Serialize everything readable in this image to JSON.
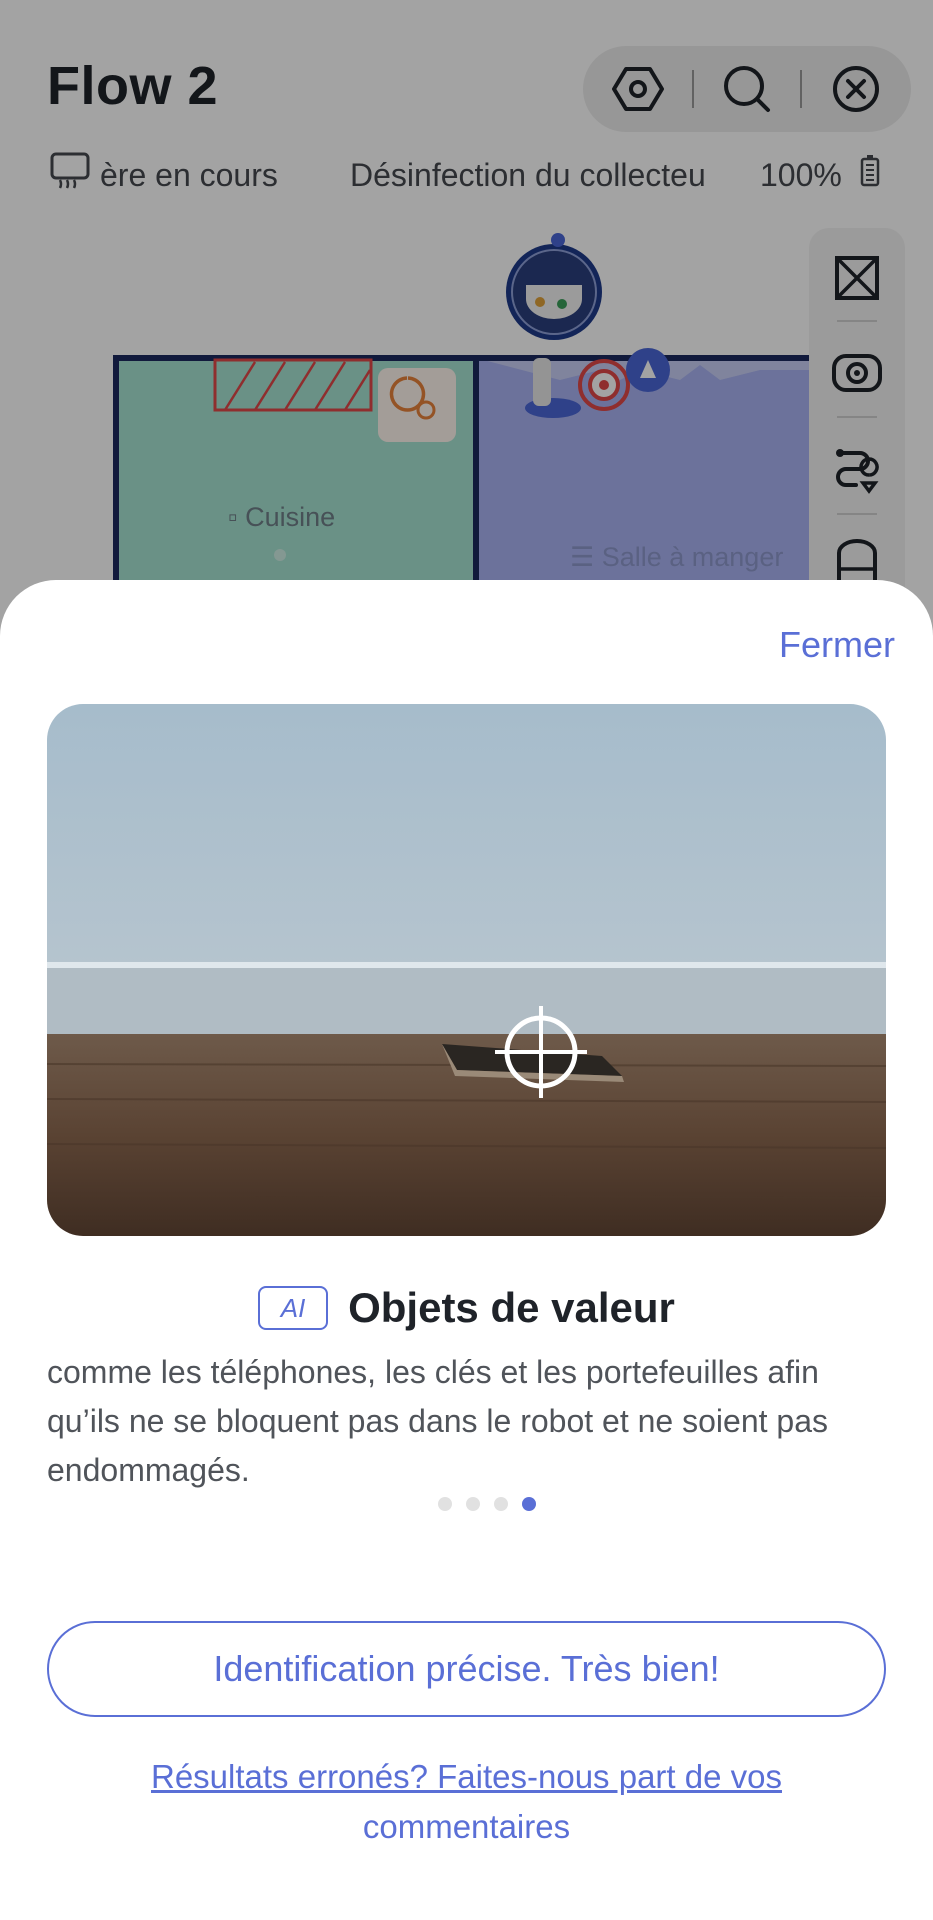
{
  "header": {
    "title": "Flow 2",
    "status_mode": "ère en cours",
    "status_task": "Désinfection du collecteu",
    "battery_percent": "100%"
  },
  "top_actions": {
    "icons": [
      "settings-hex-icon",
      "search-icon",
      "close-circle-icon"
    ]
  },
  "map": {
    "rooms": [
      {
        "name": "Cuisine",
        "color": "#a6e3d2"
      },
      {
        "name": "Salle à manger",
        "color": "#a9b3f2"
      }
    ]
  },
  "side_toolbar": {
    "icons": [
      "map-edit-icon",
      "camera-eye-icon",
      "route-pin-icon",
      "station-icon"
    ]
  },
  "sheet": {
    "close_label": "Fermer",
    "ai_badge": "AI",
    "heading": "Objets de valeur",
    "description": "comme les téléphones, les clés et les portefeuilles afin qu’ils ne se bloquent pas dans le robot et ne soient pas endommagés.",
    "page_count": 4,
    "active_page": 4,
    "confirm_label": "Identification précise. Très bien!",
    "feedback_line1": "Résultats erronés? Faites-nous part de vos",
    "feedback_line2": "commentaires"
  },
  "colors": {
    "accent": "#5a6fd6",
    "title": "#1f2329",
    "text": "#50545a"
  }
}
